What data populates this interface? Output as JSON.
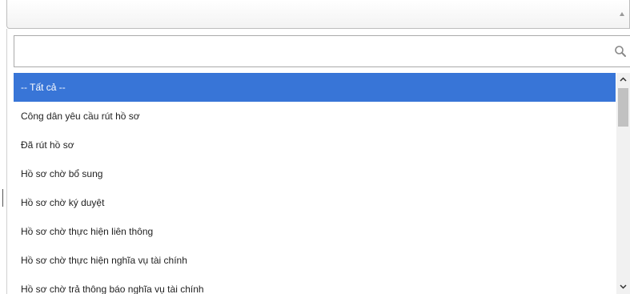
{
  "select": {
    "selected_value": ""
  },
  "search": {
    "value": "",
    "placeholder": "",
    "icon": "search-icon"
  },
  "options": [
    {
      "label": "-- Tất cả --",
      "selected": true
    },
    {
      "label": "Công dân yêu cầu rút hồ sơ",
      "selected": false
    },
    {
      "label": "Đã rút hồ sơ",
      "selected": false
    },
    {
      "label": "Hồ sơ chờ bổ sung",
      "selected": false
    },
    {
      "label": "Hồ sơ chờ ký duyệt",
      "selected": false
    },
    {
      "label": "Hồ sơ chờ thực hiện liên thông",
      "selected": false
    },
    {
      "label": "Hồ sơ chờ thực hiện nghĩa vụ tài chính",
      "selected": false
    },
    {
      "label": "Hồ sơ chờ trả thông báo nghĩa vụ tài chính",
      "selected": false
    }
  ],
  "colors": {
    "selected_bg": "#3875d7",
    "selected_text": "#ffffff",
    "text": "#1f1f1f",
    "scrollbar_thumb": "#c1c1c1"
  }
}
